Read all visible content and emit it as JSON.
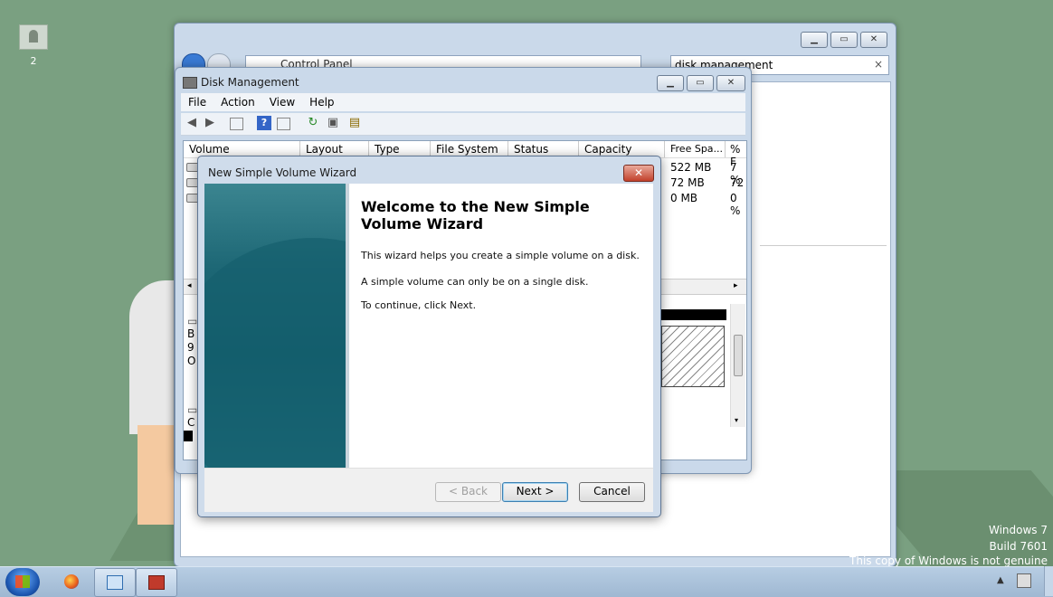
{
  "desktop": {
    "icon_label": "2",
    "watermark": {
      "line1": "Windows 7",
      "line2": "Build 7601",
      "line3": "This copy of Windows is not genuine"
    }
  },
  "control_panel": {
    "address": "Control Panel",
    "search_value": "disk management",
    "search_clear": "×"
  },
  "disk_management": {
    "title": "Disk Management",
    "menu": [
      "File",
      "Action",
      "View",
      "Help"
    ],
    "columns": [
      "Volume",
      "Layout",
      "Type",
      "File System",
      "Status",
      "Capacity",
      "Free Spa...",
      "% F"
    ],
    "rows": [
      {
        "free": "522 MB",
        "pct": "7 %"
      },
      {
        "free": "72 MB",
        "pct": "72"
      },
      {
        "free": "0 MB",
        "pct": "0 %"
      }
    ],
    "lower_letters": [
      "B",
      "9",
      "O",
      "C"
    ]
  },
  "wizard": {
    "title": "New Simple Volume Wizard",
    "close_glyph": "✕",
    "heading": "Welcome to the New Simple Volume Wizard",
    "para1": "This wizard helps you create a simple volume on a disk.",
    "para2": "A simple volume can only be on a single disk.",
    "para3": "To continue, click Next.",
    "back_label": "< Back",
    "next_label": "Next >",
    "cancel_label": "Cancel"
  },
  "icons": {
    "back": "arrow-left-icon",
    "forward": "arrow-right-icon",
    "help": "help-icon",
    "refresh": "refresh-icon",
    "properties": "properties-icon",
    "disk": "disk-icon"
  },
  "colors": {
    "desktop_bg": "#7aa081",
    "window_frame": "#cad9ea",
    "wizard_side": "#0f5b6a",
    "close_red": "#c2412b"
  }
}
